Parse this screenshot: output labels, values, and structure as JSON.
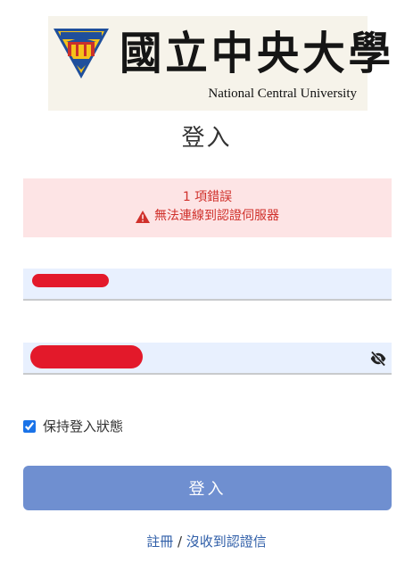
{
  "logo": {
    "chinese_name": "國立中央大學",
    "english_name": "National Central University",
    "emblem_colors": {
      "yellow": "#f4c21a",
      "blue": "#1f4f9c",
      "red": "#c9302c"
    }
  },
  "page_title": "登入",
  "error": {
    "count_text": "1 項錯誤",
    "message": "無法連線到認證伺服器",
    "icon": "warning-triangle-icon"
  },
  "username_field": {
    "value": "",
    "redacted": true
  },
  "password_field": {
    "value": "",
    "redacted": true,
    "toggle_icon": "eye-slash-icon"
  },
  "remember_me": {
    "label": "保持登入狀態",
    "checked": true
  },
  "login_button": {
    "label": "登入"
  },
  "footer": {
    "register_label": "註冊",
    "separator": " / ",
    "resend_label": "沒收到認證信"
  },
  "colors": {
    "error_bg": "#fde4e5",
    "error_text": "#d0302b",
    "field_bg": "#e8f0fe",
    "button_bg": "#6f8fd0",
    "link": "#2f5ea8",
    "redaction": "#e3192a"
  }
}
